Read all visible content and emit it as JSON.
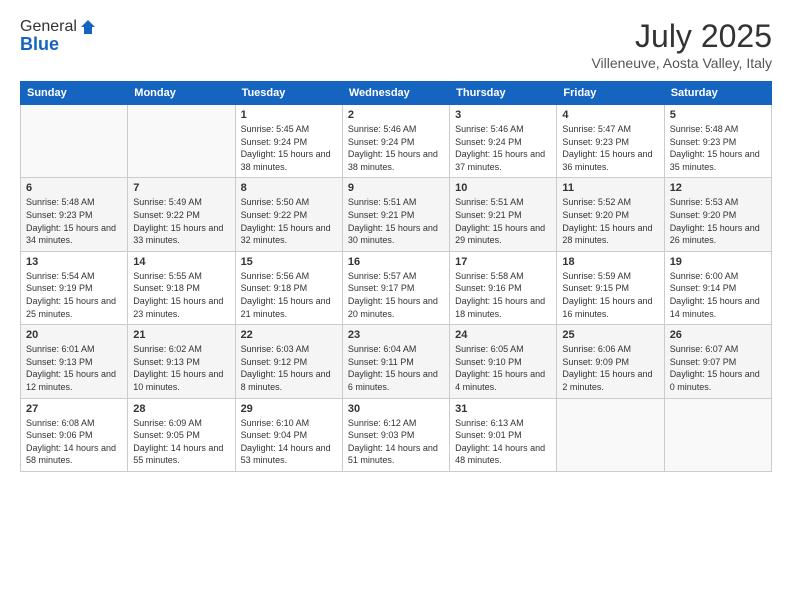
{
  "header": {
    "logo_general": "General",
    "logo_blue": "Blue",
    "month_title": "July 2025",
    "location": "Villeneuve, Aosta Valley, Italy"
  },
  "weekdays": [
    "Sunday",
    "Monday",
    "Tuesday",
    "Wednesday",
    "Thursday",
    "Friday",
    "Saturday"
  ],
  "weeks": [
    [
      {
        "day": "",
        "sunrise": "",
        "sunset": "",
        "daylight": ""
      },
      {
        "day": "",
        "sunrise": "",
        "sunset": "",
        "daylight": ""
      },
      {
        "day": "1",
        "sunrise": "Sunrise: 5:45 AM",
        "sunset": "Sunset: 9:24 PM",
        "daylight": "Daylight: 15 hours and 38 minutes."
      },
      {
        "day": "2",
        "sunrise": "Sunrise: 5:46 AM",
        "sunset": "Sunset: 9:24 PM",
        "daylight": "Daylight: 15 hours and 38 minutes."
      },
      {
        "day": "3",
        "sunrise": "Sunrise: 5:46 AM",
        "sunset": "Sunset: 9:24 PM",
        "daylight": "Daylight: 15 hours and 37 minutes."
      },
      {
        "day": "4",
        "sunrise": "Sunrise: 5:47 AM",
        "sunset": "Sunset: 9:23 PM",
        "daylight": "Daylight: 15 hours and 36 minutes."
      },
      {
        "day": "5",
        "sunrise": "Sunrise: 5:48 AM",
        "sunset": "Sunset: 9:23 PM",
        "daylight": "Daylight: 15 hours and 35 minutes."
      }
    ],
    [
      {
        "day": "6",
        "sunrise": "Sunrise: 5:48 AM",
        "sunset": "Sunset: 9:23 PM",
        "daylight": "Daylight: 15 hours and 34 minutes."
      },
      {
        "day": "7",
        "sunrise": "Sunrise: 5:49 AM",
        "sunset": "Sunset: 9:22 PM",
        "daylight": "Daylight: 15 hours and 33 minutes."
      },
      {
        "day": "8",
        "sunrise": "Sunrise: 5:50 AM",
        "sunset": "Sunset: 9:22 PM",
        "daylight": "Daylight: 15 hours and 32 minutes."
      },
      {
        "day": "9",
        "sunrise": "Sunrise: 5:51 AM",
        "sunset": "Sunset: 9:21 PM",
        "daylight": "Daylight: 15 hours and 30 minutes."
      },
      {
        "day": "10",
        "sunrise": "Sunrise: 5:51 AM",
        "sunset": "Sunset: 9:21 PM",
        "daylight": "Daylight: 15 hours and 29 minutes."
      },
      {
        "day": "11",
        "sunrise": "Sunrise: 5:52 AM",
        "sunset": "Sunset: 9:20 PM",
        "daylight": "Daylight: 15 hours and 28 minutes."
      },
      {
        "day": "12",
        "sunrise": "Sunrise: 5:53 AM",
        "sunset": "Sunset: 9:20 PM",
        "daylight": "Daylight: 15 hours and 26 minutes."
      }
    ],
    [
      {
        "day": "13",
        "sunrise": "Sunrise: 5:54 AM",
        "sunset": "Sunset: 9:19 PM",
        "daylight": "Daylight: 15 hours and 25 minutes."
      },
      {
        "day": "14",
        "sunrise": "Sunrise: 5:55 AM",
        "sunset": "Sunset: 9:18 PM",
        "daylight": "Daylight: 15 hours and 23 minutes."
      },
      {
        "day": "15",
        "sunrise": "Sunrise: 5:56 AM",
        "sunset": "Sunset: 9:18 PM",
        "daylight": "Daylight: 15 hours and 21 minutes."
      },
      {
        "day": "16",
        "sunrise": "Sunrise: 5:57 AM",
        "sunset": "Sunset: 9:17 PM",
        "daylight": "Daylight: 15 hours and 20 minutes."
      },
      {
        "day": "17",
        "sunrise": "Sunrise: 5:58 AM",
        "sunset": "Sunset: 9:16 PM",
        "daylight": "Daylight: 15 hours and 18 minutes."
      },
      {
        "day": "18",
        "sunrise": "Sunrise: 5:59 AM",
        "sunset": "Sunset: 9:15 PM",
        "daylight": "Daylight: 15 hours and 16 minutes."
      },
      {
        "day": "19",
        "sunrise": "Sunrise: 6:00 AM",
        "sunset": "Sunset: 9:14 PM",
        "daylight": "Daylight: 15 hours and 14 minutes."
      }
    ],
    [
      {
        "day": "20",
        "sunrise": "Sunrise: 6:01 AM",
        "sunset": "Sunset: 9:13 PM",
        "daylight": "Daylight: 15 hours and 12 minutes."
      },
      {
        "day": "21",
        "sunrise": "Sunrise: 6:02 AM",
        "sunset": "Sunset: 9:13 PM",
        "daylight": "Daylight: 15 hours and 10 minutes."
      },
      {
        "day": "22",
        "sunrise": "Sunrise: 6:03 AM",
        "sunset": "Sunset: 9:12 PM",
        "daylight": "Daylight: 15 hours and 8 minutes."
      },
      {
        "day": "23",
        "sunrise": "Sunrise: 6:04 AM",
        "sunset": "Sunset: 9:11 PM",
        "daylight": "Daylight: 15 hours and 6 minutes."
      },
      {
        "day": "24",
        "sunrise": "Sunrise: 6:05 AM",
        "sunset": "Sunset: 9:10 PM",
        "daylight": "Daylight: 15 hours and 4 minutes."
      },
      {
        "day": "25",
        "sunrise": "Sunrise: 6:06 AM",
        "sunset": "Sunset: 9:09 PM",
        "daylight": "Daylight: 15 hours and 2 minutes."
      },
      {
        "day": "26",
        "sunrise": "Sunrise: 6:07 AM",
        "sunset": "Sunset: 9:07 PM",
        "daylight": "Daylight: 15 hours and 0 minutes."
      }
    ],
    [
      {
        "day": "27",
        "sunrise": "Sunrise: 6:08 AM",
        "sunset": "Sunset: 9:06 PM",
        "daylight": "Daylight: 14 hours and 58 minutes."
      },
      {
        "day": "28",
        "sunrise": "Sunrise: 6:09 AM",
        "sunset": "Sunset: 9:05 PM",
        "daylight": "Daylight: 14 hours and 55 minutes."
      },
      {
        "day": "29",
        "sunrise": "Sunrise: 6:10 AM",
        "sunset": "Sunset: 9:04 PM",
        "daylight": "Daylight: 14 hours and 53 minutes."
      },
      {
        "day": "30",
        "sunrise": "Sunrise: 6:12 AM",
        "sunset": "Sunset: 9:03 PM",
        "daylight": "Daylight: 14 hours and 51 minutes."
      },
      {
        "day": "31",
        "sunrise": "Sunrise: 6:13 AM",
        "sunset": "Sunset: 9:01 PM",
        "daylight": "Daylight: 14 hours and 48 minutes."
      },
      {
        "day": "",
        "sunrise": "",
        "sunset": "",
        "daylight": ""
      },
      {
        "day": "",
        "sunrise": "",
        "sunset": "",
        "daylight": ""
      }
    ]
  ]
}
